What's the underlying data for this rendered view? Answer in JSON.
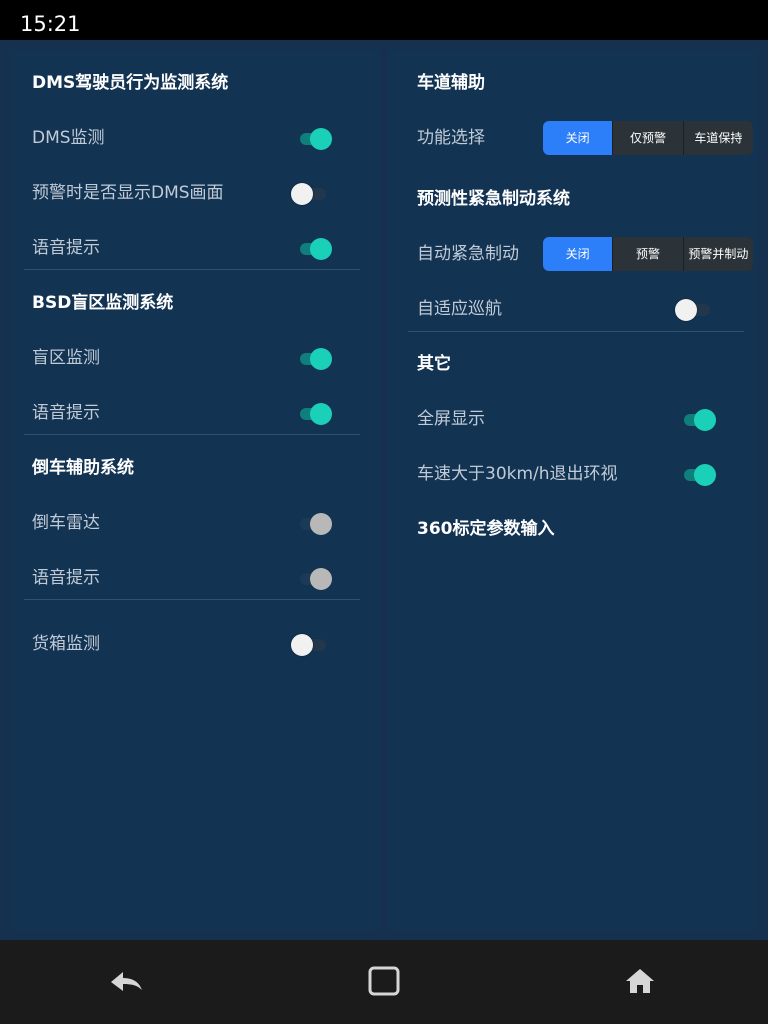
{
  "status_bar": {
    "time": "15:21"
  },
  "left": {
    "dms": {
      "title": "DMS驾驶员行为监测系统",
      "monitor": {
        "label": "DMS监测",
        "on": true
      },
      "show_screen": {
        "label": "预警时是否显示DMS画面",
        "on": false
      },
      "voice": {
        "label": "语音提示",
        "on": true
      }
    },
    "bsd": {
      "title": "BSD盲区监测系统",
      "monitor": {
        "label": "盲区监测",
        "on": true
      },
      "voice": {
        "label": "语音提示",
        "on": true
      }
    },
    "reverse": {
      "title": "倒车辅助系统",
      "radar": {
        "label": "倒车雷达",
        "on": true,
        "enabled": false
      },
      "voice": {
        "label": "语音提示",
        "on": true,
        "enabled": false
      }
    },
    "cargo": {
      "label": "货箱监测",
      "on": false
    }
  },
  "right": {
    "lane": {
      "title": "车道辅助",
      "function": {
        "label": "功能选择",
        "options": [
          "关闭",
          "仅预警",
          "车道保持"
        ],
        "selected": "关闭"
      }
    },
    "aeb": {
      "title": "预测性紧急制动系统",
      "auto_brake": {
        "label": "自动紧急制动",
        "options": [
          "关闭",
          "预警",
          "预警并制动"
        ],
        "selected": "关闭"
      },
      "acc": {
        "label": "自适应巡航",
        "on": false
      }
    },
    "other": {
      "title": "其它",
      "fullscreen": {
        "label": "全屏显示",
        "on": true
      },
      "speed_exit": {
        "label": "车速大于30km/h退出环视",
        "on": true
      },
      "calibration": "360标定参数输入"
    }
  },
  "nav": {
    "back": "back-icon",
    "recents": "recents-icon",
    "home": "home-icon"
  },
  "colors": {
    "background": "#16314f",
    "panel": "#133353",
    "accent": "#2d7ff9",
    "toggle_on": "#1bd0b9",
    "navbar": "#1b1b1b"
  }
}
